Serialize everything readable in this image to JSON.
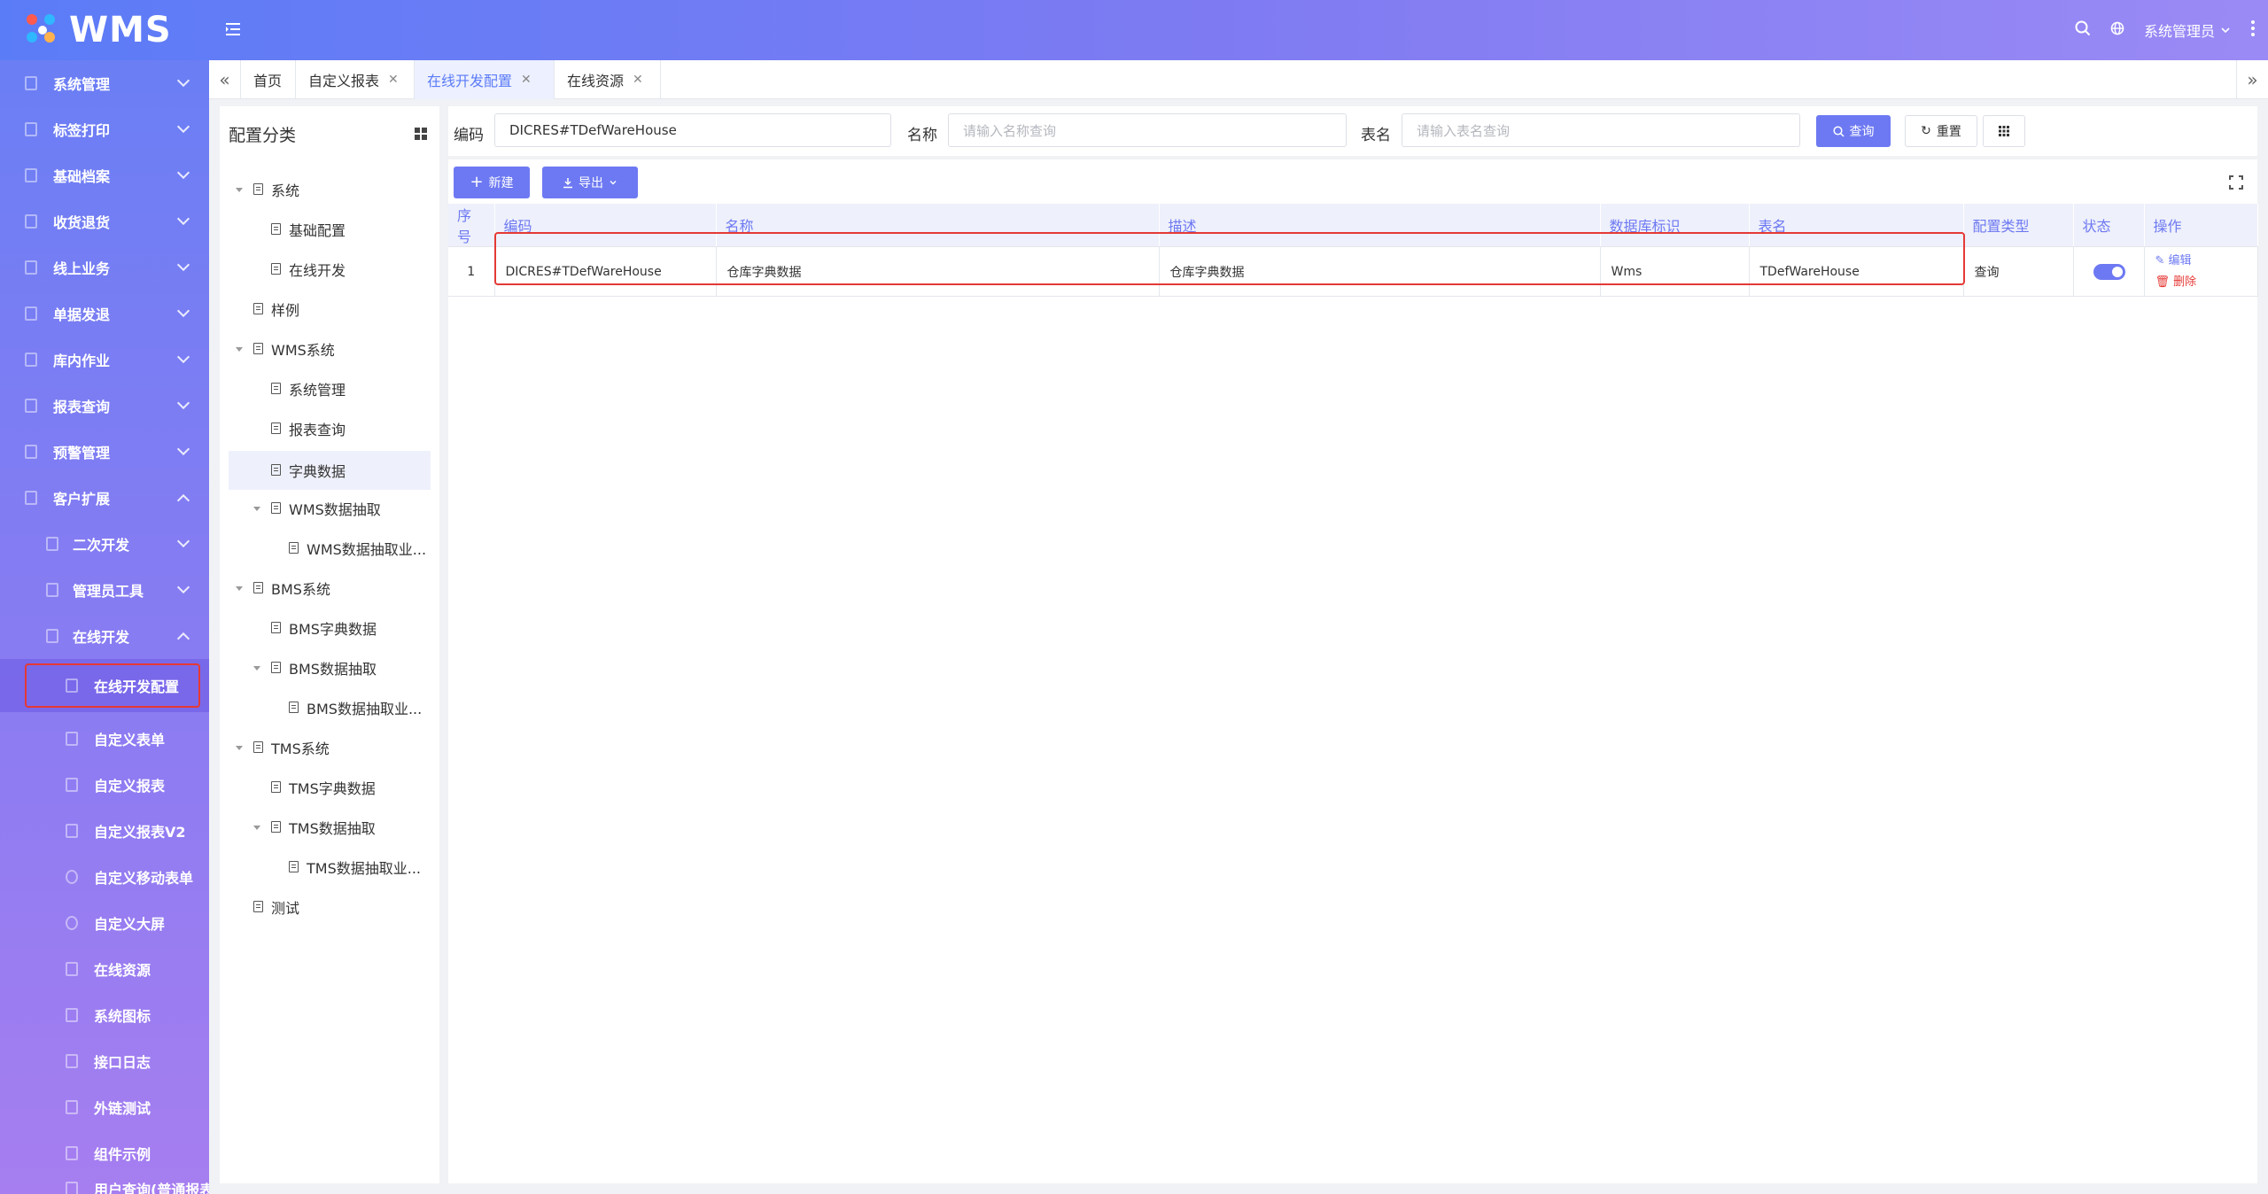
{
  "app": {
    "logo_text": "WMS"
  },
  "header": {
    "user_name": "系统管理员"
  },
  "sidebar": {
    "items": [
      {
        "label": "系统管理"
      },
      {
        "label": "标签打印"
      },
      {
        "label": "基础档案"
      },
      {
        "label": "收货退货"
      },
      {
        "label": "线上业务"
      },
      {
        "label": "单据发退"
      },
      {
        "label": "库内作业"
      },
      {
        "label": "报表查询"
      },
      {
        "label": "预警管理"
      },
      {
        "label": "客户扩展"
      },
      {
        "label": "二次开发"
      },
      {
        "label": "管理员工具"
      },
      {
        "label": "在线开发"
      },
      {
        "label": "在线开发配置"
      },
      {
        "label": "自定义表单"
      },
      {
        "label": "自定义报表"
      },
      {
        "label": "自定义报表V2"
      },
      {
        "label": "自定义移动表单"
      },
      {
        "label": "自定义大屏"
      },
      {
        "label": "在线资源"
      },
      {
        "label": "系统图标"
      },
      {
        "label": "接口日志"
      },
      {
        "label": "外链测试"
      },
      {
        "label": "组件示例"
      },
      {
        "label": "用户查询(普通报表"
      }
    ]
  },
  "tabs": [
    {
      "label": "首页"
    },
    {
      "label": "自定义报表"
    },
    {
      "label": "在线开发配置"
    },
    {
      "label": "在线资源"
    }
  ],
  "tree": {
    "title": "配置分类",
    "nodes": [
      {
        "label": "系统"
      },
      {
        "label": "基础配置"
      },
      {
        "label": "在线开发"
      },
      {
        "label": "样例"
      },
      {
        "label": "WMS系统"
      },
      {
        "label": "系统管理"
      },
      {
        "label": "报表查询"
      },
      {
        "label": "字典数据"
      },
      {
        "label": "WMS数据抽取"
      },
      {
        "label": "WMS数据抽取业..."
      },
      {
        "label": "BMS系统"
      },
      {
        "label": "BMS字典数据"
      },
      {
        "label": "BMS数据抽取"
      },
      {
        "label": "BMS数据抽取业..."
      },
      {
        "label": "TMS系统"
      },
      {
        "label": "TMS字典数据"
      },
      {
        "label": "TMS数据抽取"
      },
      {
        "label": "TMS数据抽取业..."
      },
      {
        "label": "测试"
      }
    ]
  },
  "search": {
    "code_label": "编码",
    "code_value": "DICRES#TDefWareHouse",
    "name_label": "名称",
    "name_placeholder": "请输入名称查询",
    "table_label": "表名",
    "table_placeholder": "请输入表名查询",
    "query_label": "查询",
    "reset_label": "重置"
  },
  "toolbar": {
    "new_label": "新建",
    "export_label": "导出"
  },
  "table": {
    "columns": [
      "序号",
      "编码",
      "名称",
      "描述",
      "数据库标识",
      "表名",
      "配置类型",
      "状态",
      "操作"
    ],
    "rows": [
      {
        "index": "1",
        "code": "DICRES#TDefWareHouse",
        "name": "仓库字典数据",
        "desc": "仓库字典数据",
        "db": "Wms",
        "table_name": "TDefWareHouse",
        "config_type": "查询",
        "status_on": true,
        "edit_label": "编辑",
        "delete_label": "删除"
      }
    ]
  },
  "colors": {
    "accent": "#6d79f2",
    "highlight_border": "#e53935"
  }
}
